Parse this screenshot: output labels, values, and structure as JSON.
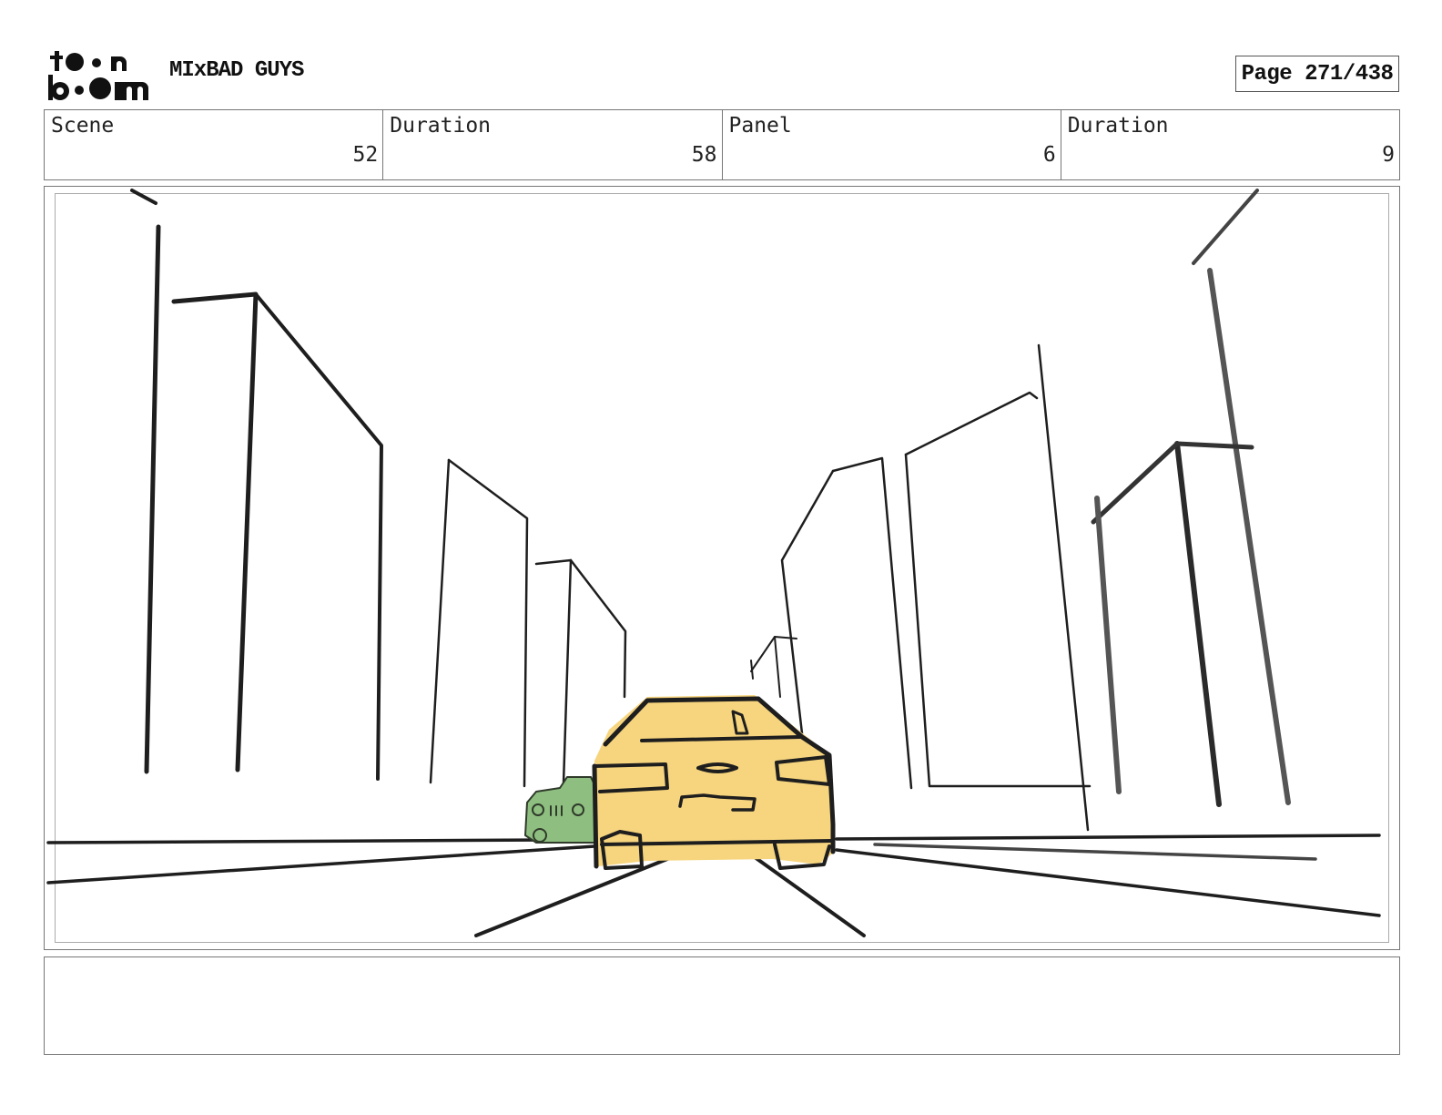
{
  "header": {
    "logo_text": "toon boom",
    "project_title": "MIxBAD GUYS",
    "page_label": "Page 271/438"
  },
  "info": {
    "scene_label": "Scene",
    "scene_value": "52",
    "scene_duration_label": "Duration",
    "scene_duration_value": "58",
    "panel_label": "Panel",
    "panel_value": "6",
    "panel_duration_label": "Duration",
    "panel_duration_value": "9"
  },
  "panel": {
    "sketch_colors": {
      "taxi_fill": "#f7d57e",
      "green_car_fill": "#8fbf80",
      "line": "#1e1e1e"
    }
  },
  "notes": {
    "text": ""
  }
}
